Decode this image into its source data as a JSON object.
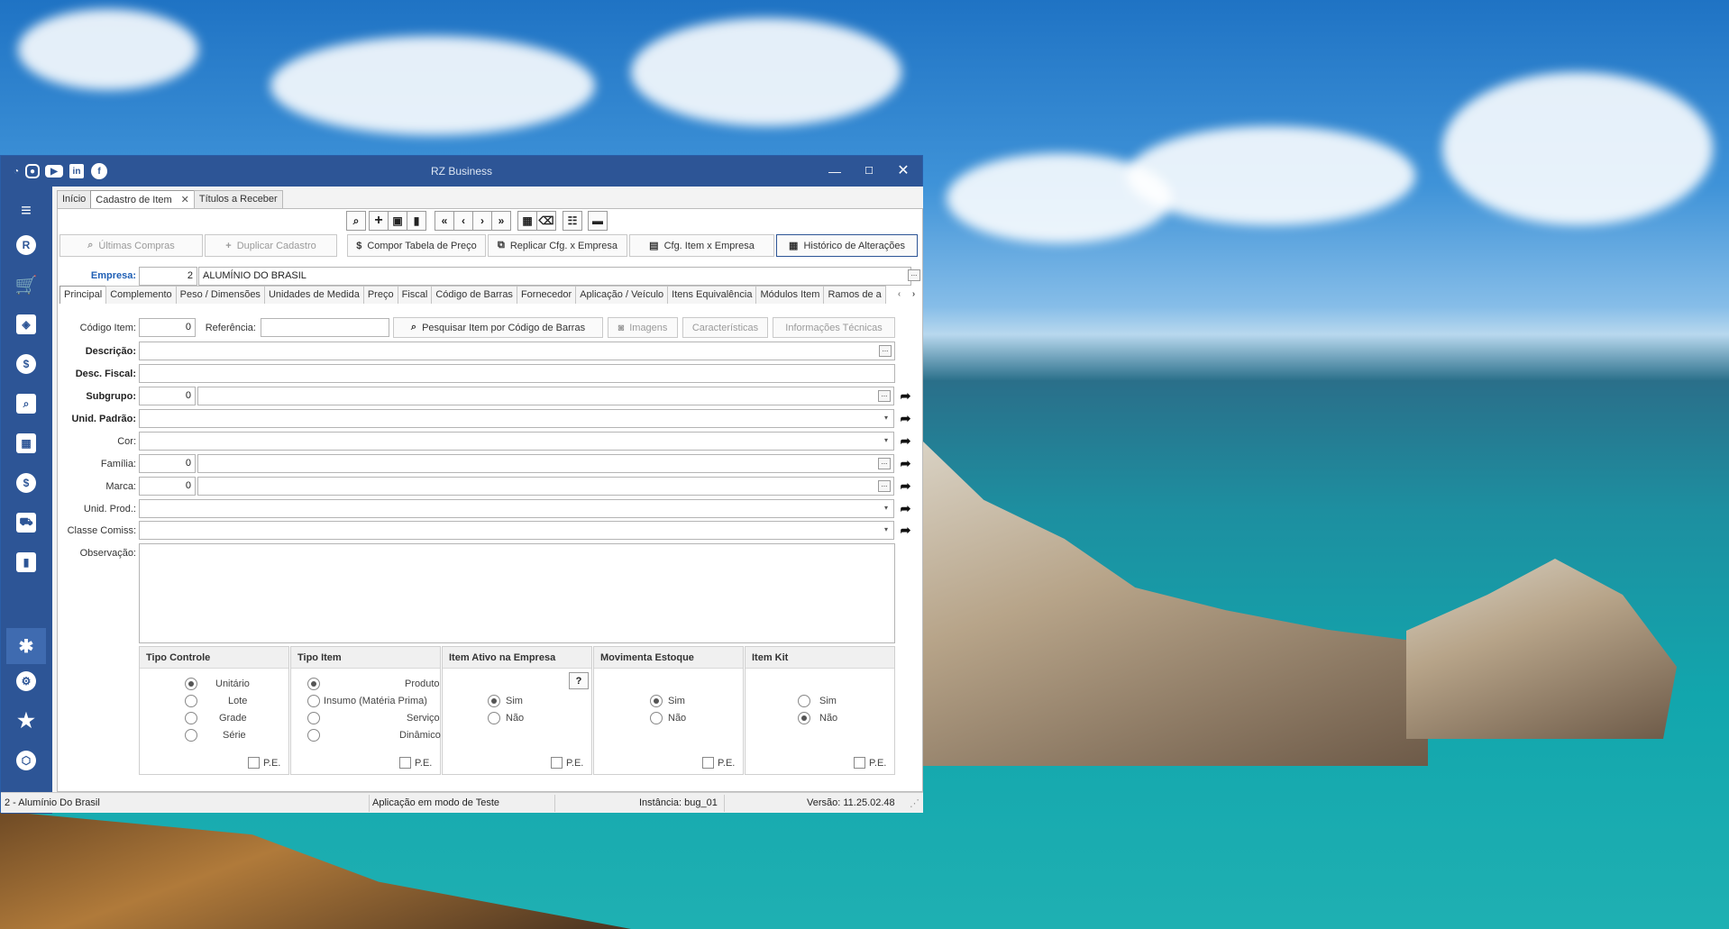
{
  "window": {
    "title": "RZ Business",
    "minimize": "—",
    "maximize": "☐",
    "close": "✕"
  },
  "doc_tabs": [
    {
      "label": "Início"
    },
    {
      "label": "Cadastro de Item",
      "close": "✕"
    },
    {
      "label": "Títulos a Receber"
    }
  ],
  "toolbar": {
    "ultimas_compras": "Últimas Compras",
    "duplicar": "Duplicar Cadastro",
    "compor": "Compor Tabela de Preço",
    "replicar": "Replicar Cfg. x Empresa",
    "cfg_item": "Cfg. Item x  Empresa",
    "historico": "Histórico de Alterações"
  },
  "empresa": {
    "label": "Empresa:",
    "code": "2",
    "name": "ALUMÍNIO DO BRASIL",
    "ellipsis": "..."
  },
  "inner_tabs": [
    "Principal",
    "Complemento",
    "Peso / Dimensões",
    "Unidades de Medida",
    "Preço",
    "Fiscal",
    "Código de Barras",
    "Fornecedor",
    "Aplicação / Veículo",
    "Itens Equivalência",
    "Módulos Item",
    "Ramos de a"
  ],
  "form": {
    "codigo_label": "Código Item:",
    "codigo_value": "0",
    "referencia_label": "Referência:",
    "pesquisar": "Pesquisar Item por Código de Barras",
    "imagens": "Imagens",
    "caracteristicas": "Características",
    "informacoes": "Informações Técnicas",
    "descricao_label": "Descrição:",
    "desc_fiscal_label": "Desc. Fiscal:",
    "subgrupo_label": "Subgrupo:",
    "subgrupo_value": "0",
    "unid_padrao_label": "Unid. Padrão:",
    "cor_label": "Cor:",
    "familia_label": "Família:",
    "familia_value": "0",
    "marca_label": "Marca:",
    "marca_value": "0",
    "unid_prod_label": "Unid. Prod.:",
    "classe_comiss_label": "Classe Comiss:",
    "observacao_label": "Observação:"
  },
  "groups": {
    "tipo_controle": {
      "title": "Tipo Controle",
      "options": [
        "Unitário",
        "Lote",
        "Grade",
        "Série"
      ],
      "pe": "P.E."
    },
    "tipo_item": {
      "title": "Tipo Item",
      "options": [
        "Produto",
        "Insumo (Matéria Prima)",
        "Serviço",
        "Dinâmico"
      ],
      "pe": "P.E."
    },
    "item_ativo": {
      "title": "Item Ativo na Empresa",
      "help": "?",
      "options": [
        "Sim",
        "Não"
      ],
      "pe": "P.E."
    },
    "movimenta_estoque": {
      "title": "Movimenta Estoque",
      "options": [
        "Sim",
        "Não"
      ],
      "pe": "P.E."
    },
    "item_kit": {
      "title": "Item Kit",
      "options": [
        "Sim",
        "Não"
      ],
      "pe": "P.E."
    }
  },
  "status": {
    "empresa": "2 - Alumínio Do Brasil",
    "modo": "Aplicação em modo de Teste",
    "instancia": "Instância: bug_01",
    "versao": "Versão: 11.25.02.48"
  }
}
